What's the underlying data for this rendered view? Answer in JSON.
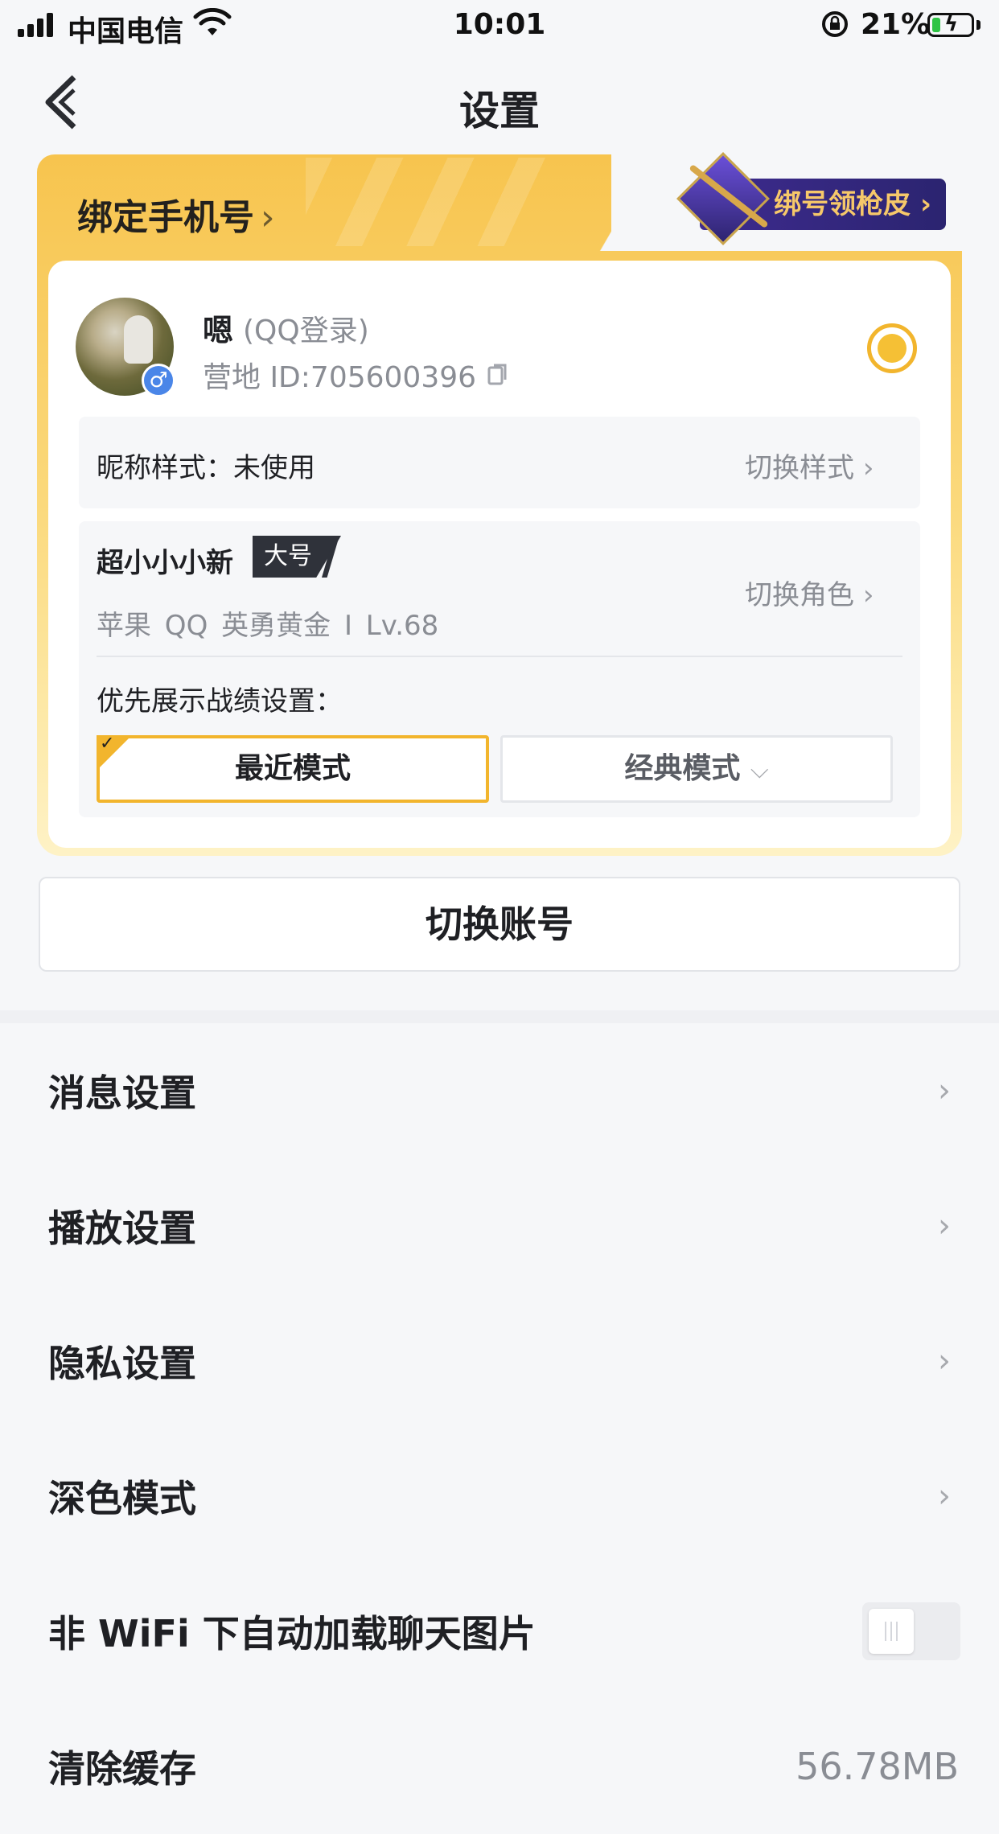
{
  "status_bar": {
    "carrier": "中国电信",
    "time": "10:01",
    "battery_percent": "21%",
    "battery_level": 0.21
  },
  "nav": {
    "title": "设置"
  },
  "account_card": {
    "bind_phone_label": "绑定手机号",
    "skin_promo_label": "绑号领枪皮",
    "user": {
      "name": "嗯",
      "login_type": "(QQ登录)",
      "camp_id": "营地 ID:705600396",
      "gender": "male"
    },
    "nickname_style": {
      "label": "昵称样式：未使用",
      "action": "切换样式"
    },
    "role": {
      "name": "超小小小新",
      "tag": "大号",
      "meta": "苹果 QQ  英勇黄金 I  Lv.68",
      "action": "切换角色"
    },
    "priority_display": {
      "label": "优先展示战绩设置：",
      "modes": [
        {
          "label": "最近模式",
          "selected": true
        },
        {
          "label": "经典模式",
          "selected": false
        }
      ]
    },
    "accent_color": "#f2b52d"
  },
  "switch_account_label": "切换账号",
  "settings": [
    {
      "label": "消息设置"
    },
    {
      "label": "播放设置"
    },
    {
      "label": "隐私设置"
    },
    {
      "label": "深色模式"
    },
    {
      "label": "非 WiFi 下自动加载聊天图片",
      "toggle": false
    },
    {
      "label": "清除缓存",
      "value": "56.78MB"
    }
  ]
}
